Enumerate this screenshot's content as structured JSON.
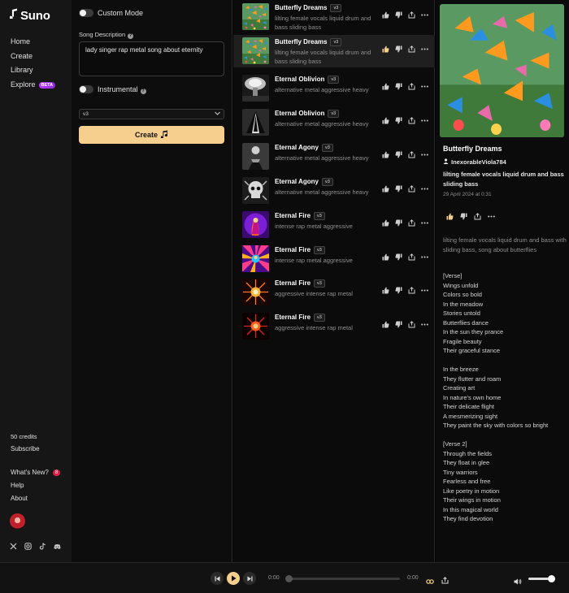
{
  "app": {
    "name": "Suno"
  },
  "nav": {
    "items": [
      {
        "label": "Home"
      },
      {
        "label": "Create"
      },
      {
        "label": "Library"
      },
      {
        "label": "Explore",
        "badge": "BETA"
      }
    ],
    "credits": "50 credits",
    "subscribe": "Subscribe",
    "whats_new": "What's New?",
    "whats_new_count": "8",
    "help": "Help",
    "about": "About",
    "social_icons": [
      "x-icon",
      "instagram-icon",
      "tiktok-icon",
      "discord-icon"
    ]
  },
  "form": {
    "custom_mode_label": "Custom Mode",
    "custom_mode_on": false,
    "song_description_label": "Song Description",
    "song_description_value": "lady singer rap metal song about eternity",
    "instrumental_label": "Instrumental",
    "instrumental_on": false,
    "model_selected": "v3",
    "create_label": "Create"
  },
  "songs": [
    {
      "title": "Butterfly Dreams",
      "version": "v3",
      "tags": "lilting female vocals liquid drum and bass sliding bass",
      "art": "butterfly",
      "liked": false
    },
    {
      "title": "Butterfly Dreams",
      "version": "v3",
      "tags": "lilting female vocals liquid drum and bass sliding bass",
      "art": "butterfly",
      "liked": true,
      "selected": true
    },
    {
      "title": "Eternal Oblivion",
      "version": "v3",
      "tags": "alternative metal aggressive heavy",
      "art": "explosion"
    },
    {
      "title": "Eternal Oblivion",
      "version": "v3",
      "tags": "alternative metal aggressive heavy",
      "art": "cloak"
    },
    {
      "title": "Eternal Agony",
      "version": "v3",
      "tags": "alternative metal aggressive heavy",
      "art": "dark-figure"
    },
    {
      "title": "Eternal Agony",
      "version": "v3",
      "tags": "alternative metal aggressive heavy",
      "art": "skull"
    },
    {
      "title": "Eternal Fire",
      "version": "v3",
      "tags": "intense rap metal aggressive",
      "art": "purple-fire"
    },
    {
      "title": "Eternal Fire",
      "version": "v3",
      "tags": "intense rap metal aggressive",
      "art": "rainbow-fire"
    },
    {
      "title": "Eternal Fire",
      "version": "v3",
      "tags": "aggressive intense rap metal",
      "art": "orange-burst"
    },
    {
      "title": "Eternal Fire",
      "version": "v3",
      "tags": "aggressive intense rap metal",
      "art": "red-burst"
    }
  ],
  "detail": {
    "title": "Butterfly Dreams",
    "user": "InexorableViola784",
    "tags": "lilting female vocals liquid drum and bass sliding bass",
    "date": "29 April 2024 at 0:31",
    "prompt": "lilting female vocals liquid drum and bass with sliding bass, song about butterflies",
    "lyrics": [
      "[Verse]",
      "Wings unfold",
      "Colors so bold",
      "In the meadow",
      "Stories untold",
      "Butterflies dance",
      "In the sun they prance",
      "Fragile beauty",
      "Their graceful stance",
      "",
      "In the breeze",
      "They flutter and roam",
      "Creating art",
      "In nature's own home",
      "Their delicate flight",
      "A mesmerizing sight",
      "They paint the sky with colors so bright",
      "",
      "[Verse 2]",
      "Through the fields",
      "They float in glee",
      "Tiny warriors",
      "Fearless and free",
      "Like poetry in motion",
      "Their wings in motion",
      "In this magical world",
      "They find devotion"
    ]
  },
  "player": {
    "current_time": "0:00",
    "duration": "0:00",
    "progress_fraction": 0.0,
    "volume_fraction": 1.0
  },
  "colors": {
    "accent": "#f6cf8f",
    "badge_red": "#e11d48",
    "beta_purple": "#a33cf0"
  }
}
